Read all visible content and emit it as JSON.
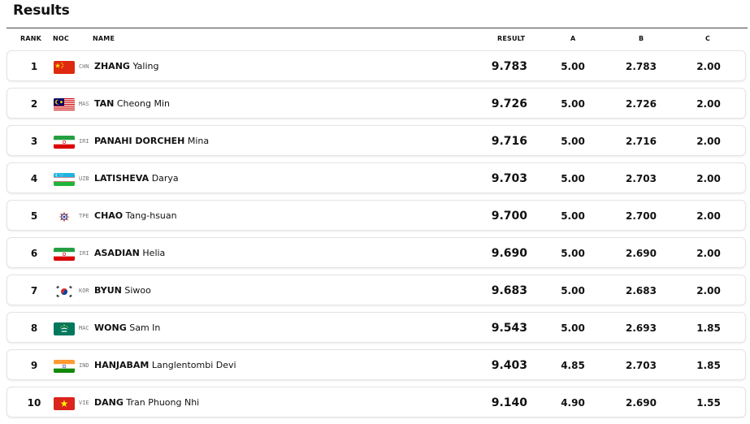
{
  "title": "Results",
  "headers": {
    "rank": "RANK",
    "noc": "NOC",
    "name": "NAME",
    "result": "RESULT",
    "a": "A",
    "b": "B",
    "c": "C"
  },
  "rows": [
    {
      "rank": "1",
      "noc": "CHN",
      "last": "ZHANG",
      "first": "Yaling",
      "result": "9.783",
      "a": "5.00",
      "b": "2.783",
      "c": "2.00",
      "flag": "china-flag-icon"
    },
    {
      "rank": "2",
      "noc": "MAS",
      "last": "TAN",
      "first": "Cheong Min",
      "result": "9.726",
      "a": "5.00",
      "b": "2.726",
      "c": "2.00",
      "flag": "malaysia-flag-icon"
    },
    {
      "rank": "3",
      "noc": "IRI",
      "last": "PANAHI DORCHEH",
      "first": "Mina",
      "result": "9.716",
      "a": "5.00",
      "b": "2.716",
      "c": "2.00",
      "flag": "iran-flag-icon"
    },
    {
      "rank": "4",
      "noc": "UZB",
      "last": "LATISHEVA",
      "first": "Darya",
      "result": "9.703",
      "a": "5.00",
      "b": "2.703",
      "c": "2.00",
      "flag": "uzbekistan-flag-icon"
    },
    {
      "rank": "5",
      "noc": "TPE",
      "last": "CHAO",
      "first": "Tang-hsuan",
      "result": "9.700",
      "a": "5.00",
      "b": "2.700",
      "c": "2.00",
      "flag": "chinese-taipei-flag-icon"
    },
    {
      "rank": "6",
      "noc": "IRI",
      "last": "ASADIAN",
      "first": "Helia",
      "result": "9.690",
      "a": "5.00",
      "b": "2.690",
      "c": "2.00",
      "flag": "iran-flag-icon"
    },
    {
      "rank": "7",
      "noc": "KOR",
      "last": "BYUN",
      "first": "Siwoo",
      "result": "9.683",
      "a": "5.00",
      "b": "2.683",
      "c": "2.00",
      "flag": "korea-flag-icon"
    },
    {
      "rank": "8",
      "noc": "MAC",
      "last": "WONG",
      "first": "Sam In",
      "result": "9.543",
      "a": "5.00",
      "b": "2.693",
      "c": "1.85",
      "flag": "macau-flag-icon"
    },
    {
      "rank": "9",
      "noc": "IND",
      "last": "HANJABAM",
      "first": "Langlentombi Devi",
      "result": "9.403",
      "a": "4.85",
      "b": "2.703",
      "c": "1.85",
      "flag": "india-flag-icon"
    },
    {
      "rank": "10",
      "noc": "VIE",
      "last": "DANG",
      "first": "Tran Phuong Nhi",
      "result": "9.140",
      "a": "4.90",
      "b": "2.690",
      "c": "1.55",
      "flag": "vietnam-flag-icon"
    }
  ]
}
